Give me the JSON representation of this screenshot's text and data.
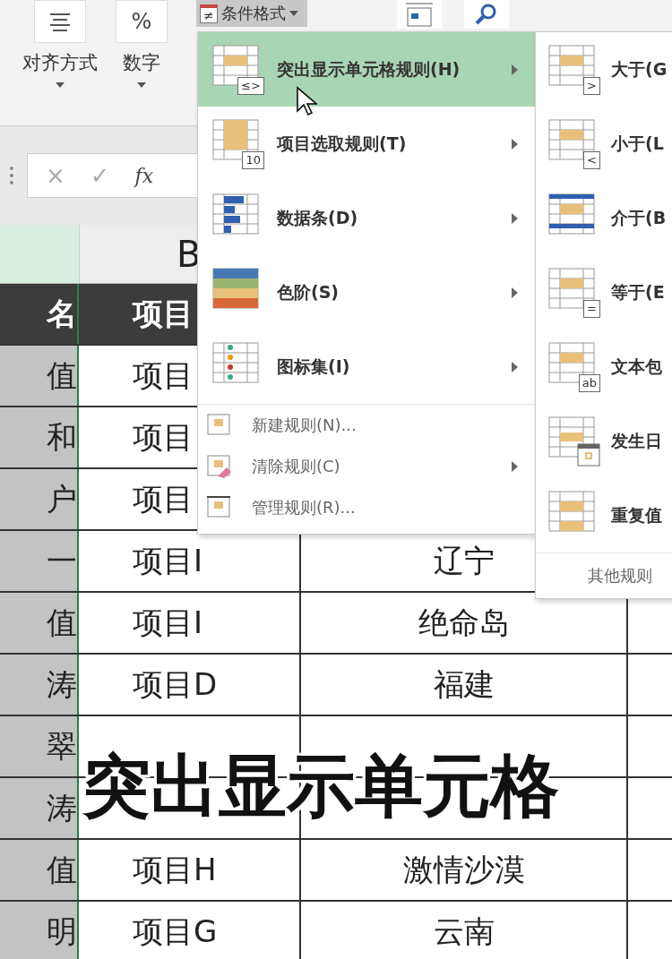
{
  "ribbon": {
    "groups": [
      {
        "label": "对齐方式",
        "kind": "align"
      },
      {
        "label": "数字",
        "kind": "glyph",
        "glyph": "%"
      }
    ],
    "conditional_format": {
      "label": "条件格式",
      "glyph": "≠",
      "selected": true
    }
  },
  "formula_bar": {
    "cancel": "×",
    "confirm": "✓",
    "fx": "fx"
  },
  "sheet": {
    "column_headers": [
      {
        "selected": true
      },
      {
        "label": "B",
        "selected": false
      }
    ],
    "rows": [
      {
        "kind": "header",
        "a": "名",
        "b": "项目"
      },
      {
        "kind": "data",
        "a": "值",
        "b": "项目"
      },
      {
        "kind": "data",
        "a": "和",
        "b": "项目"
      },
      {
        "kind": "data",
        "a": "户",
        "b": "项目"
      },
      {
        "kind": "data",
        "a": "一",
        "b": "项目I",
        "c": "辽宁"
      },
      {
        "kind": "data",
        "a": "值",
        "b": "项目I",
        "c": "绝命岛"
      },
      {
        "kind": "data",
        "a": "涛",
        "b": "项目D",
        "c": "福建"
      },
      {
        "kind": "data",
        "a": "翠"
      },
      {
        "kind": "data",
        "a": "涛"
      },
      {
        "kind": "data",
        "a": "值",
        "b": "项目H",
        "c": "激情沙漠"
      },
      {
        "kind": "data",
        "a": "明",
        "b": "项目G",
        "c": "云南"
      }
    ]
  },
  "menu": {
    "items": [
      {
        "label": "突出显示单元格规则(H)",
        "kind": "badge",
        "badge": "≤>",
        "selected": true
      },
      {
        "label": "项目选取规则(T)",
        "kind": "badge",
        "badge": "10",
        "selected": false
      },
      {
        "label": "数据条(D)",
        "kind": "databar",
        "selected": false
      },
      {
        "label": "色阶(S)",
        "kind": "colorscale",
        "selected": false
      },
      {
        "label": "图标集(I)",
        "kind": "iconset",
        "selected": false
      }
    ],
    "small_items": [
      {
        "label": "新建规则(N)...",
        "kind": "new",
        "submenu": false
      },
      {
        "label": "清除规则(C)",
        "kind": "clear",
        "submenu": true
      },
      {
        "label": "管理规则(R)...",
        "kind": "manage",
        "submenu": false
      }
    ]
  },
  "submenu": {
    "items": [
      {
        "label": "大于(G",
        "kind": "badge",
        "badge": ">"
      },
      {
        "label": "小于(L",
        "kind": "badge",
        "badge": "<"
      },
      {
        "label": "介于(B",
        "kind": "between"
      },
      {
        "label": "等于(E",
        "kind": "badge",
        "badge": "="
      },
      {
        "label": "文本包",
        "kind": "badge",
        "badge": "ab"
      },
      {
        "label": "发生日",
        "kind": "date"
      },
      {
        "label": "重复值",
        "kind": "duplicate"
      }
    ],
    "footer": "其他规则"
  },
  "caption": "突出显示单元格"
}
